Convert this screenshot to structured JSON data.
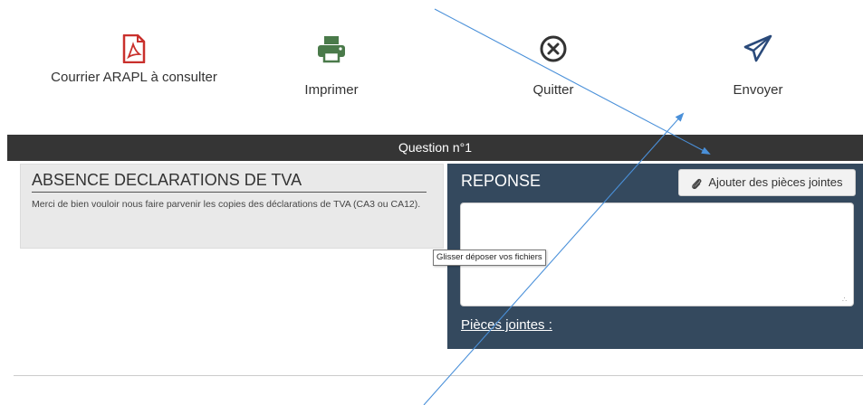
{
  "toolbar": {
    "courrier": {
      "label": "Courrier ARAPL à consulter",
      "icon": "pdf-file-icon",
      "color": "#c9302c"
    },
    "imprimer": {
      "label": "Imprimer",
      "icon": "printer-icon",
      "color": "#4a7a4a"
    },
    "quitter": {
      "label": "Quitter",
      "icon": "close-circle-icon",
      "color": "#333333"
    },
    "envoyer": {
      "label": "Envoyer",
      "icon": "paper-plane-icon",
      "color": "#2a4a7a"
    }
  },
  "question_bar": {
    "label": "Question n°1"
  },
  "question": {
    "title": "ABSENCE DECLARATIONS DE TVA",
    "text": "Merci de bien vouloir nous faire parvenir les copies des déclarations de TVA (CA3 ou CA12)."
  },
  "response": {
    "title": "REPONSE",
    "attach_button_label": "Ajouter des pièces jointes",
    "attach_icon": "paperclip-icon",
    "textarea_value": "",
    "attachments_label": "Pièces jointes :"
  },
  "tooltip": {
    "text": "Glisser déposer vos fichiers"
  },
  "colors": {
    "question_bar": "#353535",
    "response_panel": "#34495e",
    "question_panel": "#e9e9e9",
    "annotation_arrow": "#4a90d9"
  }
}
